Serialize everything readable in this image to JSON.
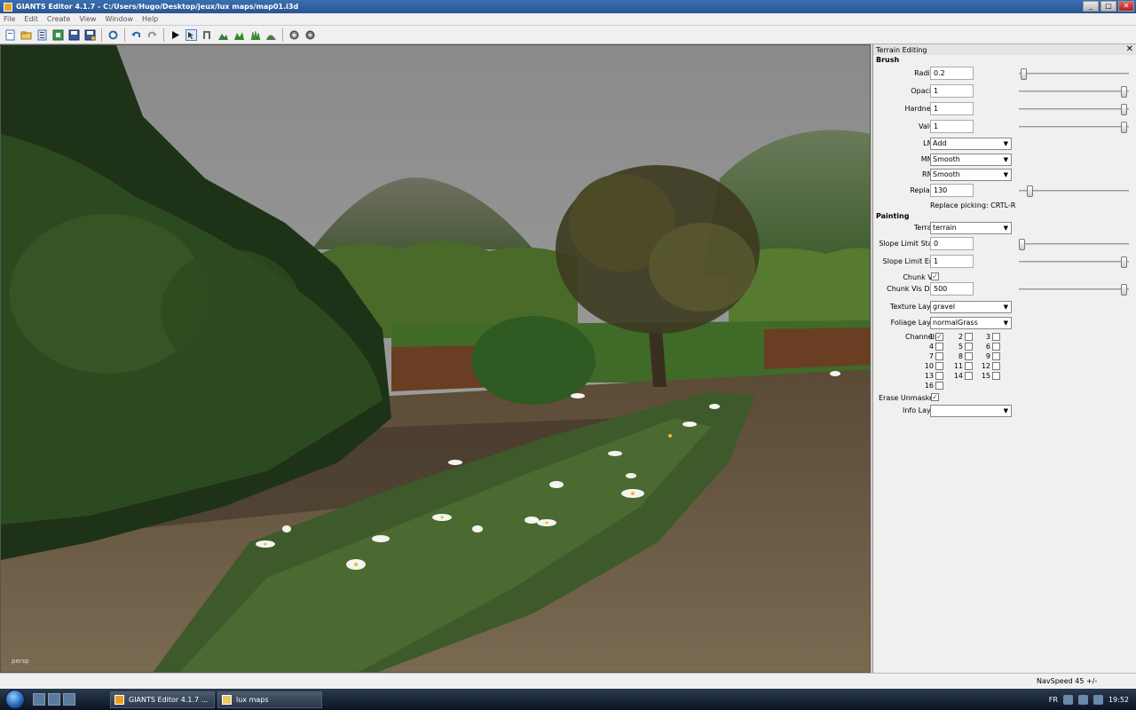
{
  "window": {
    "title": "GIANTS Editor 4.1.7 - C:/Users/Hugo/Desktop/jeux/lux maps/map01.i3d",
    "minimize": "_",
    "maximize": "□",
    "close": "✕"
  },
  "menu": {
    "items": [
      "File",
      "Edit",
      "Create",
      "View",
      "Window",
      "Help"
    ]
  },
  "toolbar": {
    "icons": [
      "new-icon",
      "open-icon",
      "list-icon",
      "export-icon",
      "save-icon",
      "save-as-icon",
      "reload-icon",
      "undo-icon",
      "redo-icon",
      "play-icon",
      "select-tool-icon",
      "move-tool-icon",
      "terrain-sculpt-icon",
      "terrain-paint-icon",
      "foliage-paint-icon",
      "terrain-smooth-icon",
      "settings-a-icon",
      "settings-b-icon"
    ]
  },
  "viewport": {
    "camera_label": "persp"
  },
  "panel": {
    "title": "Terrain Editing",
    "close": "✕",
    "brush": {
      "heading": "Brush",
      "radius": {
        "label": "Radius",
        "value": "0.2",
        "slider": 0.02
      },
      "opacity": {
        "label": "Opacity",
        "value": "1",
        "slider": 1.0
      },
      "hardness": {
        "label": "Hardness",
        "value": "1",
        "slider": 1.0
      },
      "value": {
        "label": "Value",
        "value": "1",
        "slider": 1.0
      },
      "lmb": {
        "label": "LMB",
        "value": "Add"
      },
      "mmb": {
        "label": "MMB",
        "value": "Smooth"
      },
      "rmb": {
        "label": "RMB",
        "value": "Smooth"
      },
      "replace": {
        "label": "Replace",
        "value": "130",
        "slider": 0.08
      },
      "replace_hint": "Replace picking: CRTL-R"
    },
    "painting": {
      "heading": "Painting",
      "terrain": {
        "label": "Terrain",
        "value": "terrain"
      },
      "slope_limit_start": {
        "label": "Slope Limit Start",
        "value": "0",
        "slider": 0.0
      },
      "slope_limit_end": {
        "label": "Slope Limit End",
        "value": "1",
        "slider": 1.0
      },
      "chunk_vis": {
        "label": "Chunk Vis",
        "checked": true
      },
      "chunk_vis_dist": {
        "label": "Chunk Vis Dist",
        "value": "500",
        "slider": 1.0
      },
      "texture_layer": {
        "label": "Texture Layer",
        "value": "gravel"
      },
      "foliage_layer": {
        "label": "Foliage Layer",
        "value": "normalGrass"
      },
      "channels": {
        "label": "Channels",
        "items": [
          {
            "n": "1",
            "checked": true
          },
          {
            "n": "2",
            "checked": false
          },
          {
            "n": "3",
            "checked": false
          },
          {
            "n": "4",
            "checked": false
          },
          {
            "n": "5",
            "checked": false
          },
          {
            "n": "6",
            "checked": false
          },
          {
            "n": "7",
            "checked": false
          },
          {
            "n": "8",
            "checked": false
          },
          {
            "n": "9",
            "checked": false
          },
          {
            "n": "10",
            "checked": false
          },
          {
            "n": "11",
            "checked": false
          },
          {
            "n": "12",
            "checked": false
          },
          {
            "n": "13",
            "checked": false
          },
          {
            "n": "14",
            "checked": false
          },
          {
            "n": "15",
            "checked": false
          },
          {
            "n": "16",
            "checked": false
          }
        ]
      },
      "erase_unmasked": {
        "label": "Erase Unmasked",
        "checked": true
      },
      "info_layer": {
        "label": "Info Layer",
        "value": ""
      }
    }
  },
  "status": {
    "navspeed": "NavSpeed 45 +/-"
  },
  "taskbar": {
    "items": [
      {
        "label": "GIANTS Editor 4.1.7 ...",
        "icon": "giants-app-icon"
      },
      {
        "label": "lux maps",
        "icon": "folder-icon"
      }
    ],
    "language": "FR",
    "clock": "19:52"
  },
  "colors": {
    "titlebar": "#2a5590",
    "panel_bg": "#f0f0f0",
    "taskbar": "#0c1420"
  }
}
